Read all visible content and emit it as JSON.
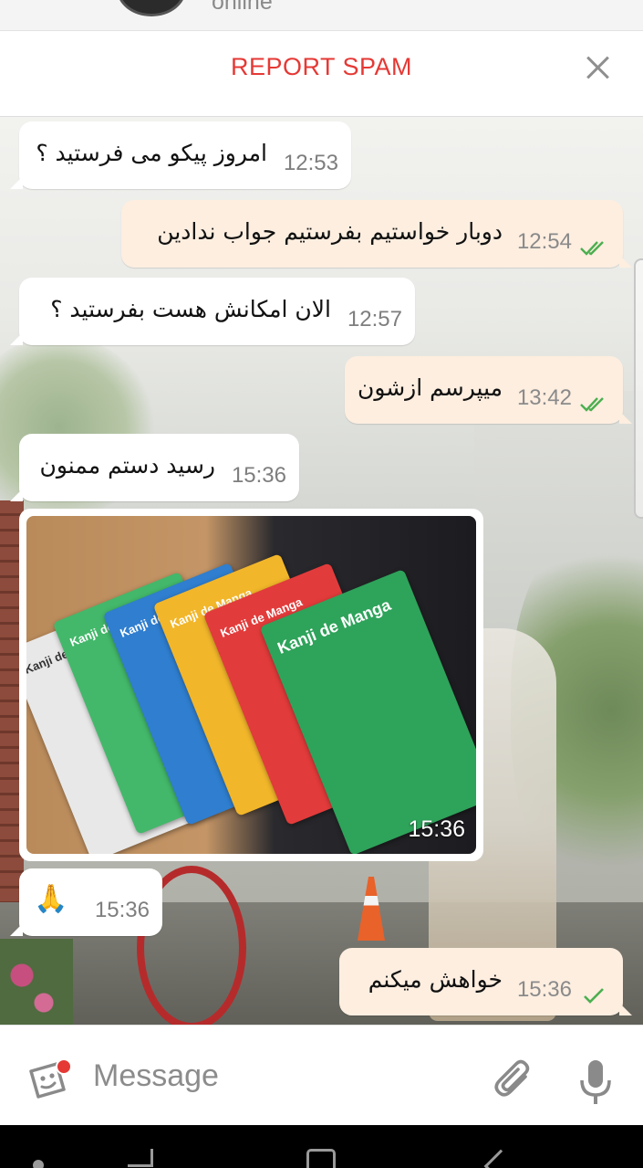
{
  "header": {
    "status": "online"
  },
  "spam_bar": {
    "label": "REPORT SPAM"
  },
  "messages": [
    {
      "dir": "in",
      "text": "امروز پیکو می فرستید ؟",
      "time": "12:53"
    },
    {
      "dir": "out",
      "text": "دوبار خواستیم بفرستیم جواب ندادین",
      "time": "12:54",
      "ticks": "double"
    },
    {
      "dir": "in",
      "text": "الان امکانش هست بفرستید ؟",
      "time": "12:57"
    },
    {
      "dir": "out",
      "text": "میپرسم ازشون",
      "time": "13:42",
      "ticks": "double"
    },
    {
      "dir": "in",
      "text": "رسید دستم ممنون",
      "time": "15:36"
    },
    {
      "dir": "in",
      "type": "photo",
      "time": "15:36"
    },
    {
      "dir": "in",
      "text": "🙏",
      "time": "15:36"
    },
    {
      "dir": "out",
      "text": "خواهش میکنم",
      "time": "15:36",
      "ticks": "single"
    }
  ],
  "photo": {
    "book_label": "Kanji de Manga"
  },
  "composer": {
    "placeholder": "Message"
  },
  "colors": {
    "accent_red": "#e53935",
    "tick_green": "#4caf50",
    "outgoing_bubble": "#fdeee0"
  }
}
